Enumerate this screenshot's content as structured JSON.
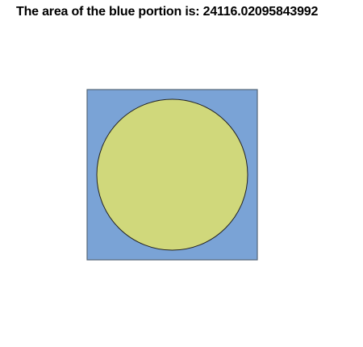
{
  "title": {
    "text": "The area of the blue portion is: 24116.02095843992"
  },
  "colors": {
    "square_fill": "#7aa3d6",
    "square_stroke": "#556677",
    "circle_fill": "#d0d87b",
    "circle_stroke": "#222222",
    "text": "#000000",
    "background": "#ffffff"
  }
}
